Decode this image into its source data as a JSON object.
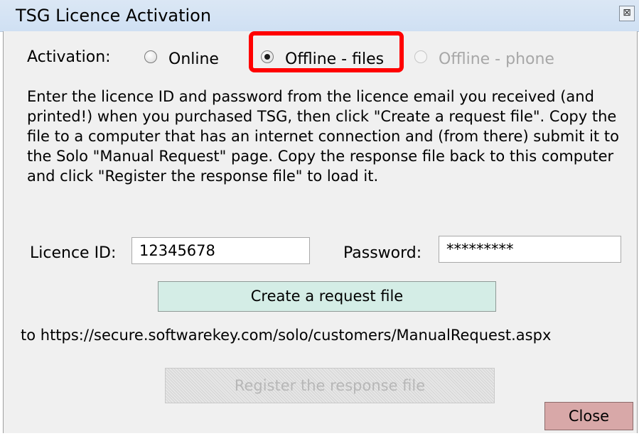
{
  "window": {
    "title": "TSG Licence Activation",
    "close_glyph": "⊠"
  },
  "activation": {
    "label": "Activation:",
    "options": [
      {
        "label": "Online",
        "selected": false,
        "enabled": true
      },
      {
        "label": "Offline - files",
        "selected": true,
        "enabled": true
      },
      {
        "label": "Offline - phone",
        "selected": false,
        "enabled": false
      }
    ]
  },
  "instructions": "Enter the licence ID and password from the licence email you received (and printed!) when you purchased TSG, then click \"Create a request file\".   Copy the file to a computer that has an internet connection and (from there) submit it to the Solo \"Manual Request\" page.   Copy the response file back to this computer and click \"Register the response file\" to load it.",
  "licence": {
    "id_label": "Licence ID:",
    "id_value": "12345678",
    "password_label": "Password:",
    "password_value": "*********"
  },
  "buttons": {
    "create": "Create a request file",
    "register": "Register the response file",
    "close": "Close"
  },
  "url_text": "to https://secure.softwarekey.com/solo/customers/ManualRequest.aspx",
  "colors": {
    "highlight": "#ff0000",
    "create_button": "#d4ede6",
    "close_button": "#d8a8a8"
  }
}
